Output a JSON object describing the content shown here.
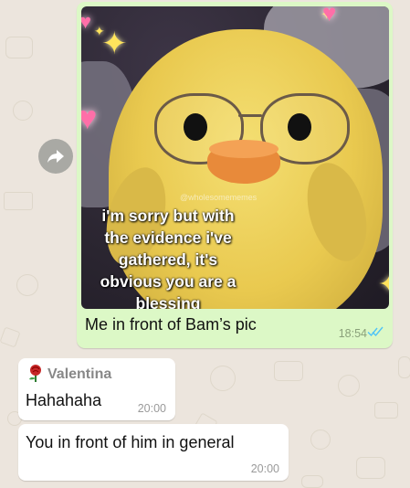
{
  "chat": {
    "outgoing": {
      "image": {
        "watermark": "@wholesomememes",
        "meme_text": "i'm sorry but with\nthe evidence i've\ngathered, it's\nobvious you are a\nblessing"
      },
      "caption": "Me in front of Bam’s pic",
      "time": "18:54",
      "read_status": "read",
      "colors": {
        "bubble": "#dcf8c6",
        "ticks": "#4fc3f7"
      }
    },
    "incoming": [
      {
        "sender": "Valentina",
        "text": "Hahahaha",
        "time": "20:00"
      },
      {
        "text": "You in front of him in general",
        "time": "20:00"
      }
    ],
    "icons": {
      "forward": "forward-arrow-icon",
      "sender_emoji": "rose-icon"
    },
    "colors": {
      "background": "#ece5dd",
      "incoming_bubble": "#ffffff"
    }
  }
}
